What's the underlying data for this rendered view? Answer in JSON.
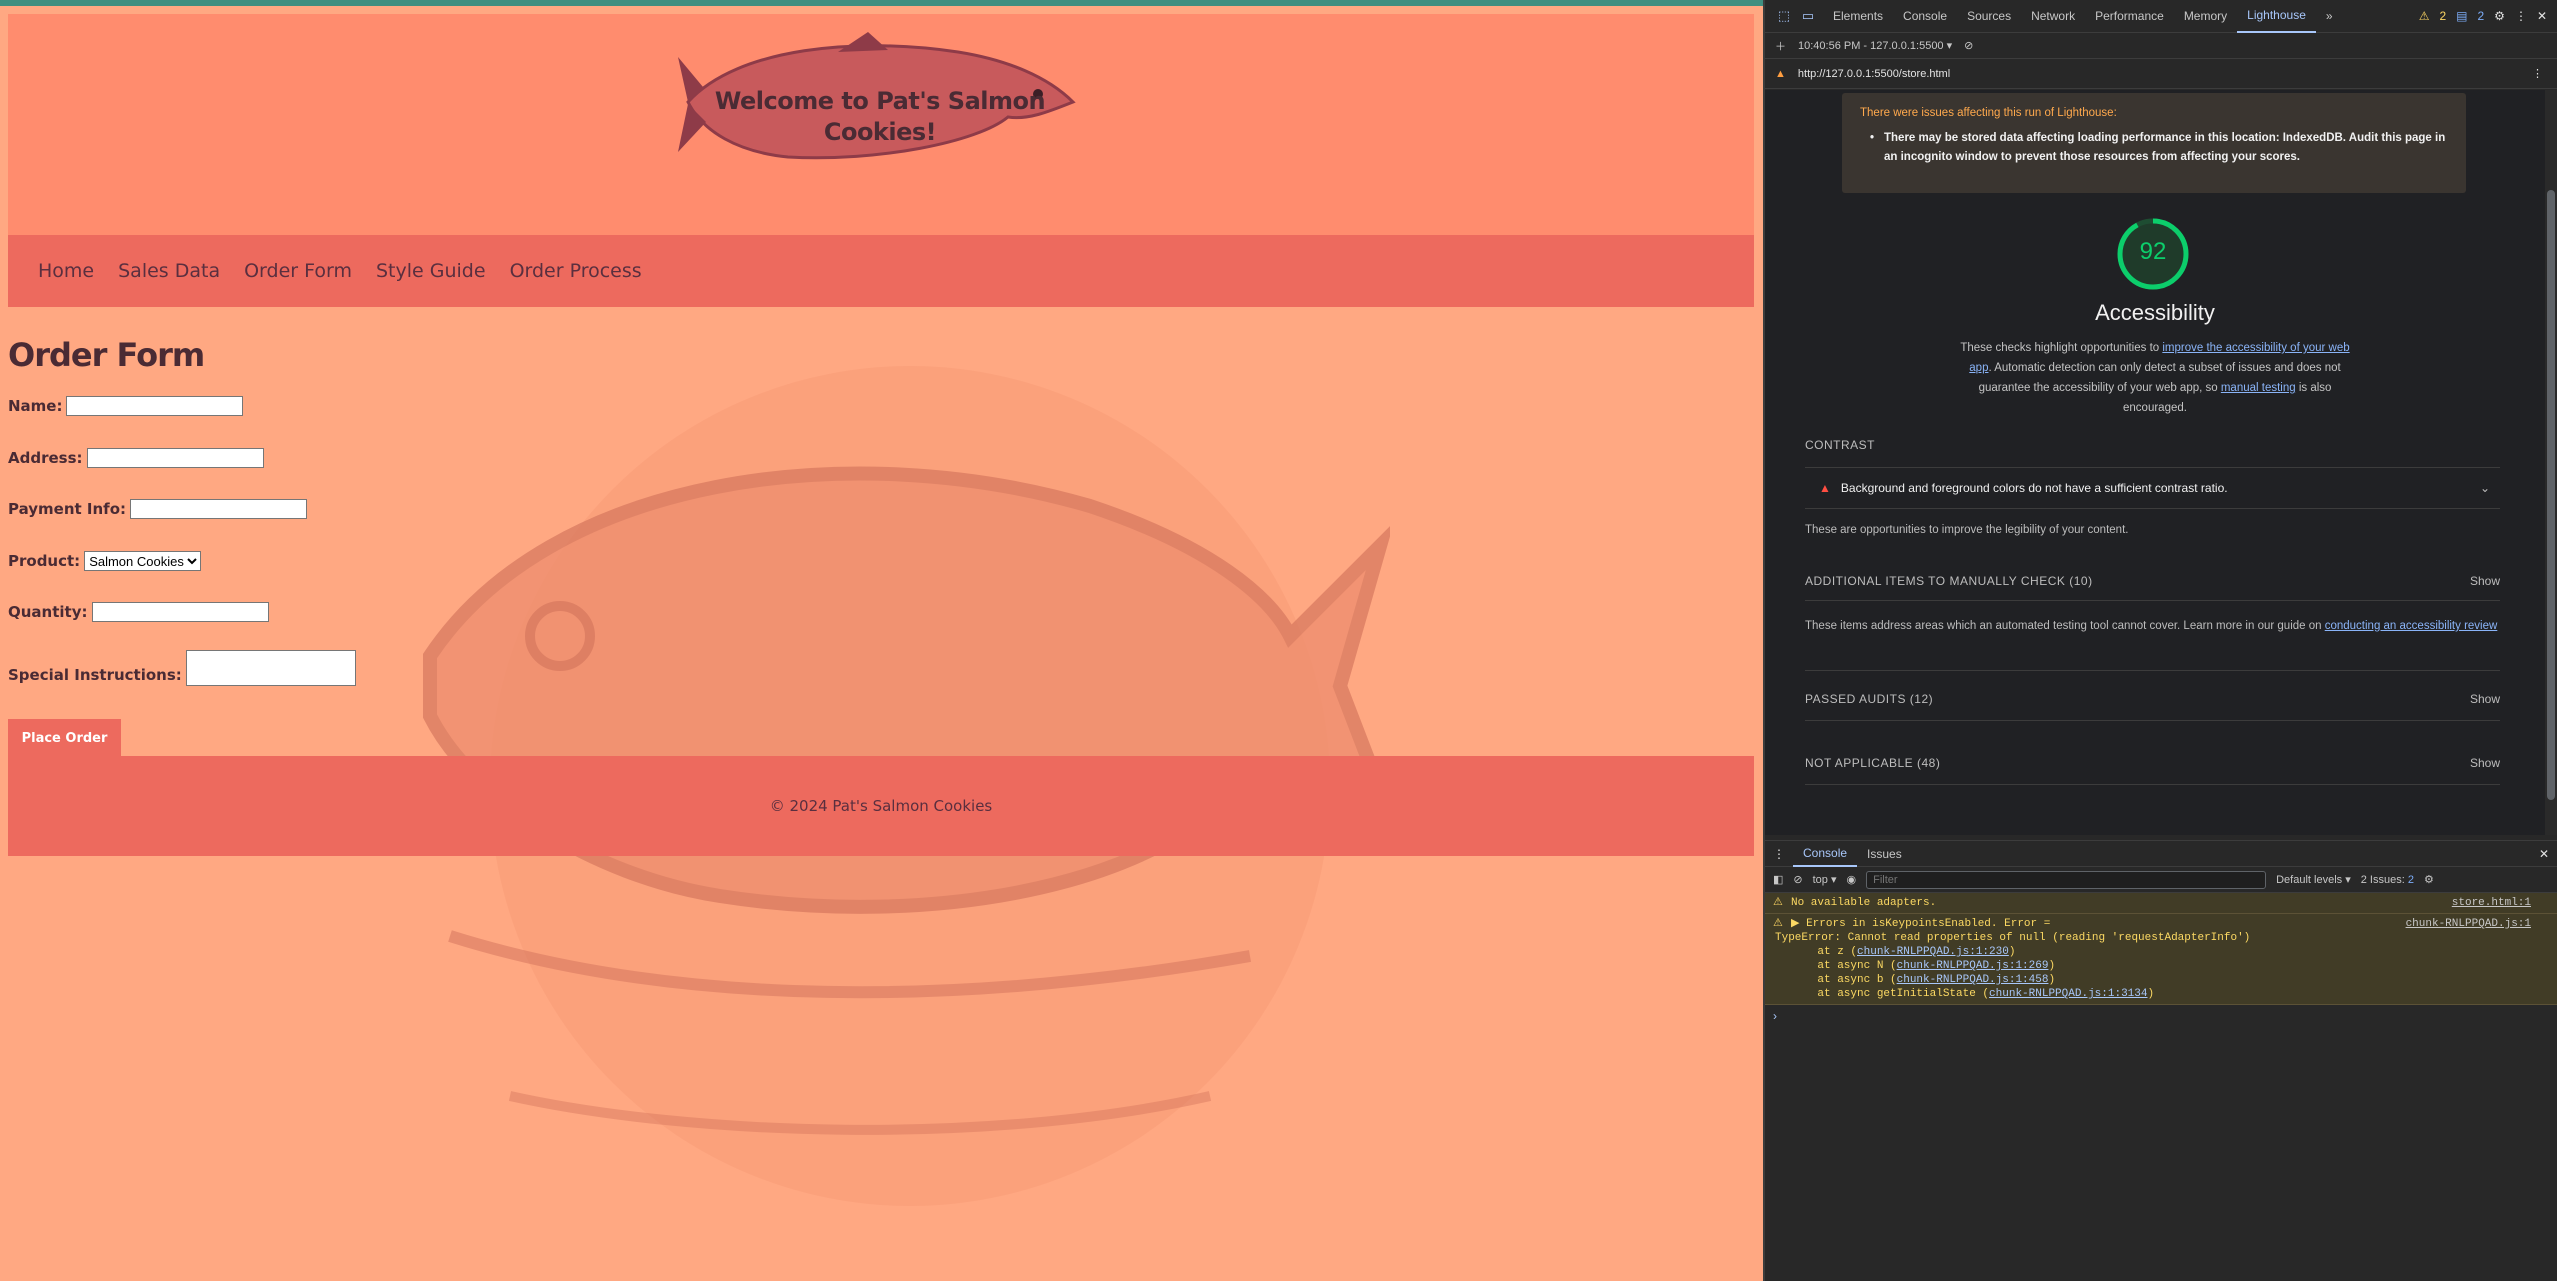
{
  "site": {
    "title": "Welcome to Pat's Salmon Cookies!",
    "nav": [
      "Home",
      "Sales Data",
      "Order Form",
      "Style Guide",
      "Order Process"
    ],
    "form": {
      "heading": "Order Form",
      "name_label": "Name:",
      "address_label": "Address:",
      "payment_label": "Payment Info:",
      "product_label": "Product:",
      "product_selected": "Salmon Cookies",
      "quantity_label": "Quantity:",
      "instructions_label": "Special Instructions:",
      "submit_label": "Place Order"
    },
    "footer": "© 2024 Pat's Salmon Cookies"
  },
  "devtools": {
    "tabs": [
      "Elements",
      "Console",
      "Sources",
      "Network",
      "Performance",
      "Memory",
      "Lighthouse"
    ],
    "active_tab": "Lighthouse",
    "warning_count": "2",
    "info_count": "2",
    "run_label": "10:40:56 PM - 127.0.0.1:5500",
    "url": "http://127.0.0.1:5500/store.html",
    "lighthouse": {
      "issue_title": "There were issues affecting this run of Lighthouse:",
      "issue_text": "There may be stored data affecting loading performance in this location: IndexedDB. Audit this page in an incognito window to prevent those resources from affecting your scores.",
      "score": "92",
      "score_fraction": 0.92,
      "category": "Accessibility",
      "desc_a": "These checks highlight opportunities to ",
      "desc_link1": "improve the accessibility of your web app",
      "desc_b": ". Automatic detection can only detect a subset of issues and does not guarantee the accessibility of your web app, so ",
      "desc_link2": "manual testing",
      "desc_c": " is also encouraged.",
      "contrast_heading": "CONTRAST",
      "contrast_item": "Background and foreground colors do not have a sufficient contrast ratio.",
      "contrast_note": "These are opportunities to improve the legibility of your content.",
      "manual_heading": "ADDITIONAL ITEMS TO MANUALLY CHECK (10)",
      "manual_note_a": "These items address areas which an automated testing tool cannot cover. Learn more in our guide on ",
      "manual_note_link": "conducting an accessibility review",
      "passed_heading": "PASSED AUDITS (12)",
      "na_heading": "NOT APPLICABLE (48)",
      "show_label": "Show"
    },
    "drawer": {
      "tabs": [
        "Console",
        "Issues"
      ],
      "context": "top",
      "filter_placeholder": "Filter",
      "levels": "Default levels",
      "issues_label": "2 Issues:",
      "issues_count": "2",
      "messages": [
        {
          "text": "No available adapters.",
          "source": "store.html:1"
        },
        {
          "text": "Errors in isKeypointsEnabled. Error =",
          "source": "chunk-RNLPPQAD.js:1"
        }
      ],
      "trace_error": "TypeError: Cannot read properties of null (reading 'requestAdapterInfo')",
      "trace": [
        {
          "prefix": "    at z (",
          "link": "chunk-RNLPPQAD.js:1:230",
          "suffix": ")"
        },
        {
          "prefix": "    at async N (",
          "link": "chunk-RNLPPQAD.js:1:269",
          "suffix": ")"
        },
        {
          "prefix": "    at async b (",
          "link": "chunk-RNLPPQAD.js:1:458",
          "suffix": ")"
        },
        {
          "prefix": "    at async getInitialState (",
          "link": "chunk-RNLPPQAD.js:1:3134",
          "suffix": ")"
        }
      ]
    }
  },
  "colors": {
    "page_bg": "#ffa882",
    "header_bg": "#ff8c6e",
    "nav_bg": "#ed6a5e",
    "text_dark": "#4a2b34",
    "score_green": "#0cce6b"
  }
}
